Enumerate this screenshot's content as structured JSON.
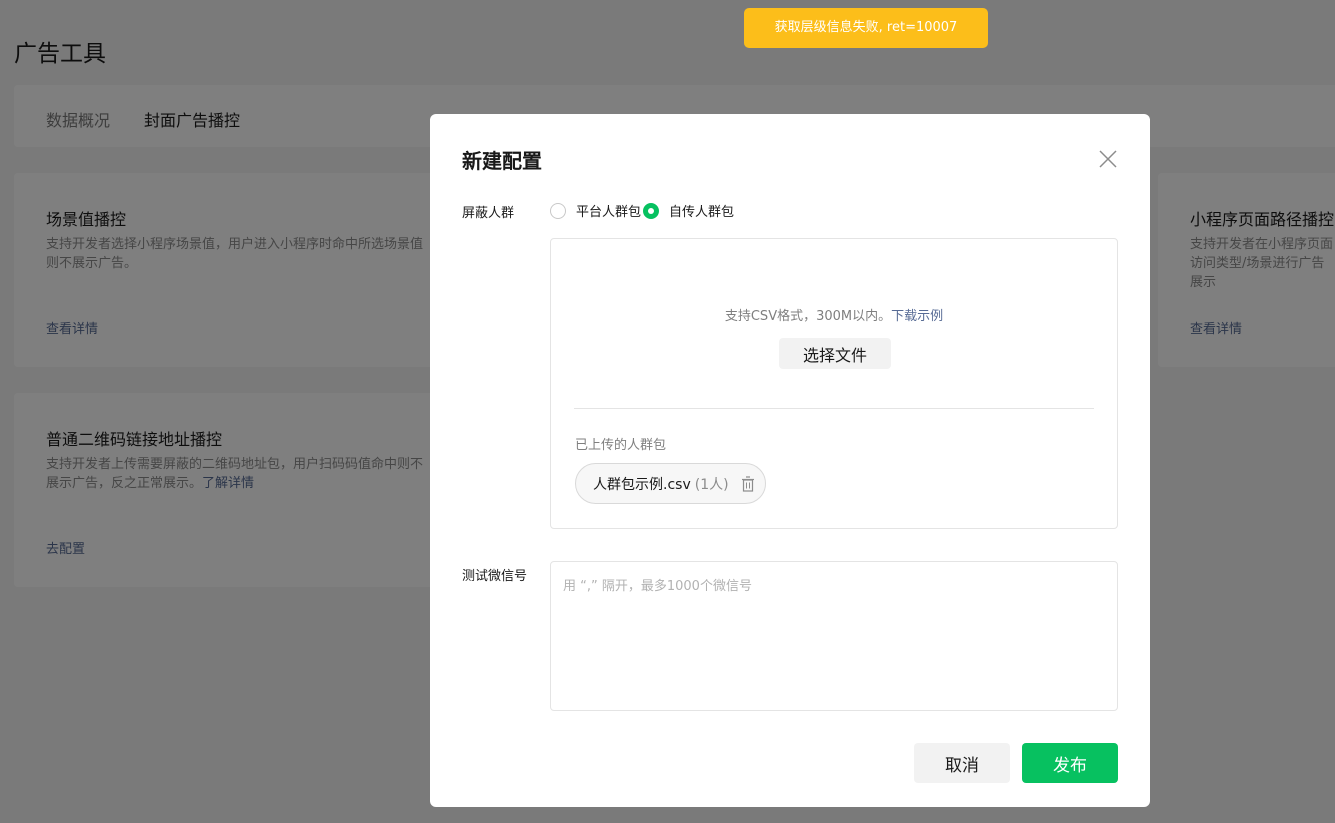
{
  "page": {
    "title": "广告工具",
    "tabs": [
      {
        "label": "数据概况"
      },
      {
        "label": "封面广告播控"
      }
    ]
  },
  "cards": [
    {
      "title": "场景值播控",
      "desc": "支持开发者选择小程序场景值，用户进入小程序时命中所选场景值则不展示广告。",
      "link": "查看详情"
    },
    {
      "title": "普通二维码链接地址播控",
      "desc": "支持开发者上传需要屏蔽的二维码地址包，用户扫码码值命中则不展示广告，反之正常展示。",
      "desc_link": "了解详情",
      "link": "去配置"
    },
    {
      "title": "小程序页面路径播控",
      "desc": "支持开发者在小程序页面访问类型/场景进行广告展示",
      "link": "查看详情"
    }
  ],
  "toast": {
    "message": "获取层级信息失败, ret=10007"
  },
  "dialog": {
    "title": "新建配置",
    "crowd_label": "屏蔽人群",
    "radio_options": [
      {
        "label": "平台人群包",
        "checked": false
      },
      {
        "label": "自传人群包",
        "checked": true
      }
    ],
    "upload": {
      "hint": "支持CSV格式，300M以内。",
      "download_link": "下载示例",
      "choose_button": "选择文件",
      "uploaded_label": "已上传的人群包",
      "file_name": "人群包示例.csv",
      "file_count": "(1人)"
    },
    "test_label": "测试微信号",
    "test_placeholder": "用 “,” 隔开，最多1000个微信号",
    "cancel_button": "取消",
    "publish_button": "发布"
  },
  "colors": {
    "primary": "#07c160",
    "link": "#576b95",
    "toast": "#fcbe1a"
  }
}
